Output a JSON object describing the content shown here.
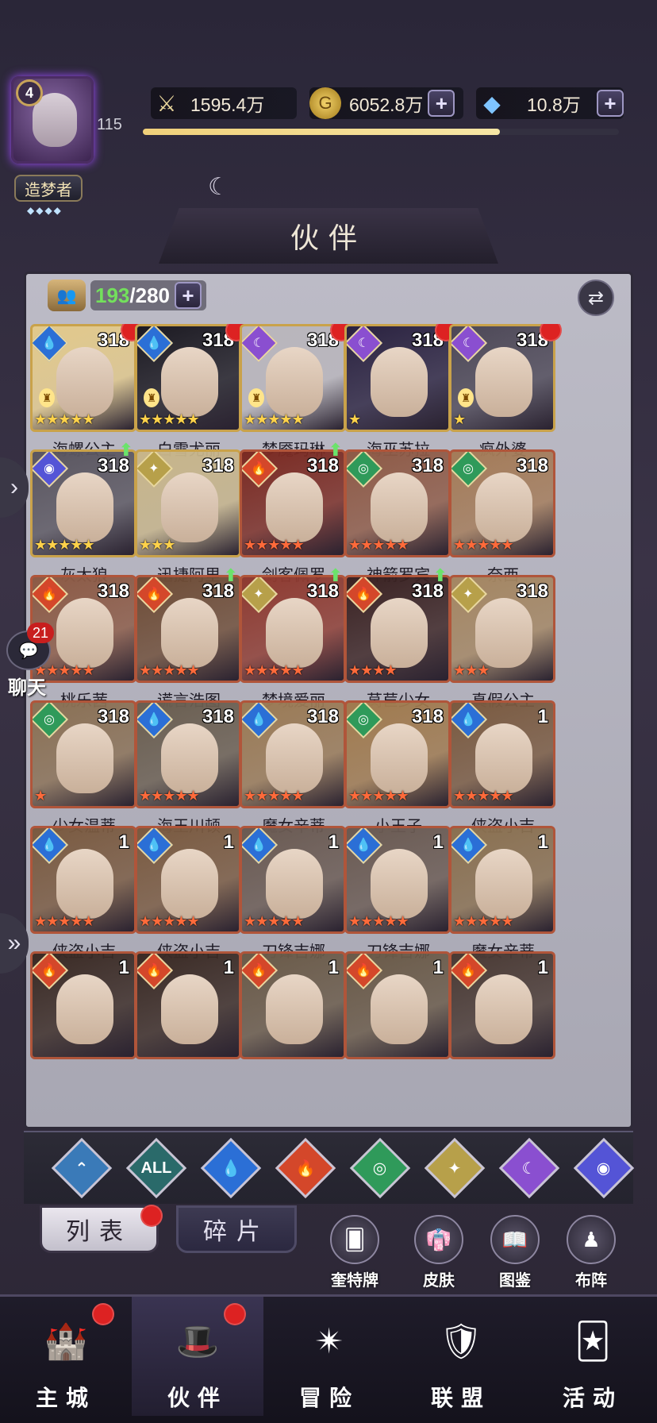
{
  "player": {
    "level": "4",
    "title": "造梦者",
    "title_stars": "◆◆◆◆",
    "account_level": "115",
    "xp_fraction": 0.75
  },
  "resources": [
    {
      "icon": "sword-icon",
      "value": "1595.4万",
      "has_plus": false
    },
    {
      "icon": "gold-coin-icon",
      "value": "6052.8万",
      "has_plus": true
    },
    {
      "icon": "diamond-icon",
      "value": "10.8万",
      "has_plus": true
    }
  ],
  "header": {
    "title": "伙伴"
  },
  "roster": {
    "current": "193",
    "sep": "/",
    "max": "280"
  },
  "heroes": [
    {
      "name": "海螺公主",
      "level": "318",
      "element": "water",
      "stars": "★★★★★",
      "star_color": "gold",
      "red_dot": true,
      "upgrade": false,
      "lock": true,
      "frame": "#c9a24a",
      "bg": "#e2c98b"
    },
    {
      "name": "白雪尤丽",
      "level": "318",
      "element": "water",
      "stars": "★★★★★",
      "star_color": "gold",
      "red_dot": true,
      "upgrade": false,
      "lock": true,
      "frame": "#c9a24a",
      "bg": "#1c1a22"
    },
    {
      "name": "梦魇玛琳",
      "level": "318",
      "element": "dark",
      "stars": "★★★★★",
      "star_color": "gold",
      "red_dot": true,
      "upgrade": false,
      "lock": true,
      "frame": "#c9a24a",
      "bg": "#b9b6bc"
    },
    {
      "name": "海巫苏拉",
      "level": "318",
      "element": "dark",
      "stars": "★",
      "star_color": "gold",
      "red_dot": true,
      "upgrade": false,
      "lock": false,
      "frame": "#c9a24a",
      "bg": "#2a2240"
    },
    {
      "name": "疯外婆",
      "level": "318",
      "element": "dark",
      "stars": "★",
      "star_color": "gold",
      "red_dot": true,
      "upgrade": false,
      "lock": true,
      "frame": "#c9a24a",
      "bg": "#4d4857"
    },
    {
      "name": "灰太狼",
      "level": "318",
      "element": "cosmic",
      "stars": "★★★★★",
      "star_color": "gold",
      "red_dot": false,
      "upgrade": true,
      "lock": false,
      "frame": "#c9a24a",
      "bg": "#5a5660"
    },
    {
      "name": "迅捷阿里",
      "level": "318",
      "element": "light",
      "stars": "★★★",
      "star_color": "gold",
      "red_dot": false,
      "upgrade": false,
      "lock": false,
      "frame": "#c9a24a",
      "bg": "#c7b58a"
    },
    {
      "name": "剑客佩罗",
      "level": "318",
      "element": "fire",
      "stars": "★★★★★",
      "star_color": "red",
      "red_dot": false,
      "upgrade": true,
      "lock": false,
      "frame": "#b0553a",
      "bg": "#7a2a22"
    },
    {
      "name": "神箭罗宾",
      "level": "318",
      "element": "wind",
      "stars": "★★★★★",
      "star_color": "red",
      "red_dot": false,
      "upgrade": false,
      "lock": false,
      "frame": "#b0553a",
      "bg": "#8e5a46"
    },
    {
      "name": "奈西",
      "level": "318",
      "element": "wind",
      "stars": "★★★★★",
      "star_color": "red",
      "red_dot": false,
      "upgrade": false,
      "lock": false,
      "frame": "#b0553a",
      "bg": "#a47b58"
    },
    {
      "name": "桃乐茜",
      "level": "318",
      "element": "fire",
      "stars": "★★★★★",
      "star_color": "red",
      "red_dot": false,
      "upgrade": false,
      "lock": false,
      "frame": "#b0553a",
      "bg": "#8c5a45"
    },
    {
      "name": "谎言浩图",
      "level": "318",
      "element": "fire",
      "stars": "★★★★★",
      "star_color": "red",
      "red_dot": false,
      "upgrade": true,
      "lock": false,
      "frame": "#b0553a",
      "bg": "#6e4c36"
    },
    {
      "name": "梦境爱丽",
      "level": "318",
      "element": "light",
      "stars": "★★★★★",
      "star_color": "red",
      "red_dot": false,
      "upgrade": true,
      "lock": false,
      "frame": "#b0553a",
      "bg": "#8e3a30"
    },
    {
      "name": "莴苣少女",
      "level": "318",
      "element": "fire",
      "stars": "★★★★",
      "star_color": "red",
      "red_dot": false,
      "upgrade": true,
      "lock": false,
      "frame": "#b0553a",
      "bg": "#3a2222"
    },
    {
      "name": "真假公主",
      "level": "318",
      "element": "light",
      "stars": "★★★",
      "star_color": "red",
      "red_dot": false,
      "upgrade": false,
      "lock": false,
      "frame": "#b0553a",
      "bg": "#a48662"
    },
    {
      "name": "少女温蒂",
      "level": "318",
      "element": "wind",
      "stars": "★",
      "star_color": "red",
      "red_dot": false,
      "upgrade": false,
      "lock": false,
      "frame": "#b0553a",
      "bg": "#8a7054"
    },
    {
      "name": "海王川顿",
      "level": "318",
      "element": "water",
      "stars": "★★★★★",
      "star_color": "red",
      "red_dot": false,
      "upgrade": false,
      "lock": false,
      "frame": "#b0553a",
      "bg": "#6a5e50"
    },
    {
      "name": "魔女辛蒂",
      "level": "318",
      "element": "water",
      "stars": "★★★★★",
      "star_color": "red",
      "red_dot": false,
      "upgrade": false,
      "lock": false,
      "frame": "#b0553a",
      "bg": "#9a7a55"
    },
    {
      "name": "小王子",
      "level": "318",
      "element": "wind",
      "stars": "★★★★★",
      "star_color": "red",
      "red_dot": false,
      "upgrade": false,
      "lock": false,
      "frame": "#b0553a",
      "bg": "#a07a4e"
    },
    {
      "name": "侠盗小吉",
      "level": "1",
      "element": "water",
      "stars": "★★★★★",
      "star_color": "red",
      "red_dot": false,
      "upgrade": false,
      "lock": false,
      "frame": "#b0553a",
      "bg": "#7a5a40"
    },
    {
      "name": "侠盗小吉",
      "level": "1",
      "element": "water",
      "stars": "★★★★★",
      "star_color": "red",
      "red_dot": false,
      "upgrade": false,
      "lock": false,
      "frame": "#b0553a",
      "bg": "#7a5a40"
    },
    {
      "name": "侠盗小吉",
      "level": "1",
      "element": "water",
      "stars": "★★★★★",
      "star_color": "red",
      "red_dot": false,
      "upgrade": false,
      "lock": false,
      "frame": "#b0553a",
      "bg": "#7a5a40"
    },
    {
      "name": "刀锋吉娜",
      "level": "1",
      "element": "water",
      "stars": "★★★★★",
      "star_color": "red",
      "red_dot": false,
      "upgrade": false,
      "lock": false,
      "frame": "#b0553a",
      "bg": "#6a5a52"
    },
    {
      "name": "刀锋吉娜",
      "level": "1",
      "element": "water",
      "stars": "★★★★★",
      "star_color": "red",
      "red_dot": false,
      "upgrade": false,
      "lock": false,
      "frame": "#b0553a",
      "bg": "#6a5a52"
    },
    {
      "name": "魔女辛蒂",
      "level": "1",
      "element": "water",
      "stars": "★★★★★",
      "star_color": "red",
      "red_dot": false,
      "upgrade": false,
      "lock": false,
      "frame": "#b0553a",
      "bg": "#8a7050"
    },
    {
      "name": "",
      "level": "1",
      "element": "fire",
      "stars": "",
      "star_color": "red",
      "red_dot": false,
      "upgrade": false,
      "lock": false,
      "frame": "#b0553a",
      "bg": "#3a2a24"
    },
    {
      "name": "",
      "level": "1",
      "element": "fire",
      "stars": "",
      "star_color": "red",
      "red_dot": false,
      "upgrade": false,
      "lock": false,
      "frame": "#b0553a",
      "bg": "#3a2a24"
    },
    {
      "name": "",
      "level": "1",
      "element": "fire",
      "stars": "",
      "star_color": "red",
      "red_dot": false,
      "upgrade": false,
      "lock": false,
      "frame": "#b0553a",
      "bg": "#6a5a48"
    },
    {
      "name": "",
      "level": "1",
      "element": "fire",
      "stars": "",
      "star_color": "red",
      "red_dot": false,
      "upgrade": false,
      "lock": false,
      "frame": "#b0553a",
      "bg": "#6a5a48"
    },
    {
      "name": "",
      "level": "1",
      "element": "fire",
      "stars": "",
      "star_color": "red",
      "red_dot": false,
      "upgrade": false,
      "lock": false,
      "frame": "#b0553a",
      "bg": "#4a3a34"
    }
  ],
  "element_icons": {
    "water": "💧",
    "dark": "☾",
    "fire": "🔥",
    "wind": "◎",
    "light": "✦",
    "cosmic": "◉"
  },
  "element_colors": {
    "water": "#2b6fd6",
    "dark": "#8a4fd0",
    "fire": "#d4472a",
    "wind": "#2f9a5a",
    "light": "#b7a04a",
    "cosmic": "#5454d6"
  },
  "filters": [
    {
      "name": "filter-all-chevron-icon",
      "label": "⌃",
      "color": "#3a7ab8"
    },
    {
      "name": "filter-all-button",
      "label": "ALL",
      "color": "#2a6a6a"
    },
    {
      "name": "filter-water-icon",
      "label": "💧",
      "color": "#2b6fd6"
    },
    {
      "name": "filter-fire-icon",
      "label": "🔥",
      "color": "#d4472a"
    },
    {
      "name": "filter-wind-icon",
      "label": "◎",
      "color": "#2f9a5a"
    },
    {
      "name": "filter-light-icon",
      "label": "✦",
      "color": "#b7a04a"
    },
    {
      "name": "filter-dark-icon",
      "label": "☾",
      "color": "#8a4fd0"
    },
    {
      "name": "filter-cosmic-icon",
      "label": "◉",
      "color": "#5454d6"
    }
  ],
  "tabs": {
    "list": "列表",
    "shards": "碎片"
  },
  "quick_actions": [
    {
      "label": "奎特牌",
      "icon": "card-deck-icon",
      "glyph": "🂠"
    },
    {
      "label": "皮肤",
      "icon": "skin-icon",
      "glyph": "👘"
    },
    {
      "label": "图鉴",
      "icon": "album-icon",
      "glyph": "📖"
    },
    {
      "label": "布阵",
      "icon": "formation-icon",
      "glyph": "♟"
    }
  ],
  "chat": {
    "label": "聊天",
    "badge": "21"
  },
  "nav": [
    {
      "label": "主城",
      "icon": "castle-icon",
      "glyph": "🏰",
      "red_dot": true,
      "active": false
    },
    {
      "label": "伙伴",
      "icon": "witch-hat-icon",
      "glyph": "🎩",
      "red_dot": true,
      "active": true
    },
    {
      "label": "冒险",
      "icon": "compass-icon",
      "glyph": "✴",
      "red_dot": false,
      "active": false
    },
    {
      "label": "联盟",
      "icon": "shield-icon",
      "glyph": "🛡",
      "red_dot": false,
      "active": false
    },
    {
      "label": "活动",
      "icon": "cards-icon",
      "glyph": "🃏",
      "red_dot": false,
      "active": false
    }
  ]
}
